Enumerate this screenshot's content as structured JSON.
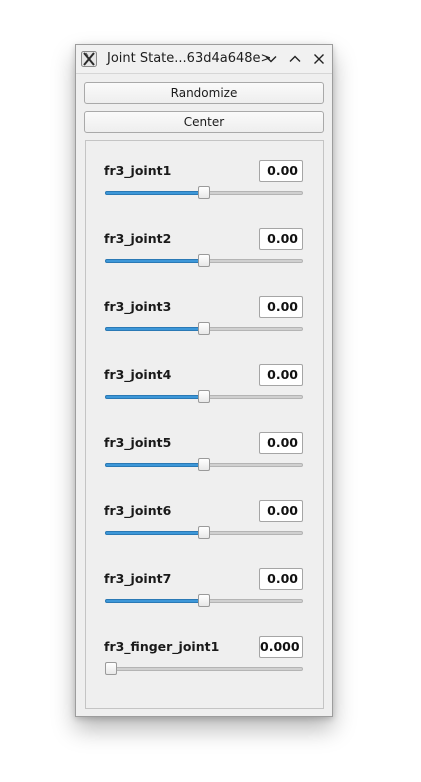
{
  "window": {
    "title": "Joint State...63d4a648e>"
  },
  "buttons": {
    "randomize": "Randomize",
    "center": "Center"
  },
  "joints": [
    {
      "label": "fr3_joint1",
      "value": "0.00",
      "slider_fraction": 0.5
    },
    {
      "label": "fr3_joint2",
      "value": "0.00",
      "slider_fraction": 0.5
    },
    {
      "label": "fr3_joint3",
      "value": "0.00",
      "slider_fraction": 0.5
    },
    {
      "label": "fr3_joint4",
      "value": "0.00",
      "slider_fraction": 0.5
    },
    {
      "label": "fr3_joint5",
      "value": "0.00",
      "slider_fraction": 0.5
    },
    {
      "label": "fr3_joint6",
      "value": "0.00",
      "slider_fraction": 0.5
    },
    {
      "label": "fr3_joint7",
      "value": "0.00",
      "slider_fraction": 0.5
    },
    {
      "label": "fr3_finger_joint1",
      "value": "0.000",
      "slider_fraction": 0.0
    }
  ],
  "icons": {
    "app": "x11-app-icon",
    "minimize": "chevron-down-icon",
    "maximize": "chevron-up-icon",
    "close": "close-icon"
  },
  "colors": {
    "slider_fill": "#3d97d8",
    "window_bg": "#efefef"
  }
}
